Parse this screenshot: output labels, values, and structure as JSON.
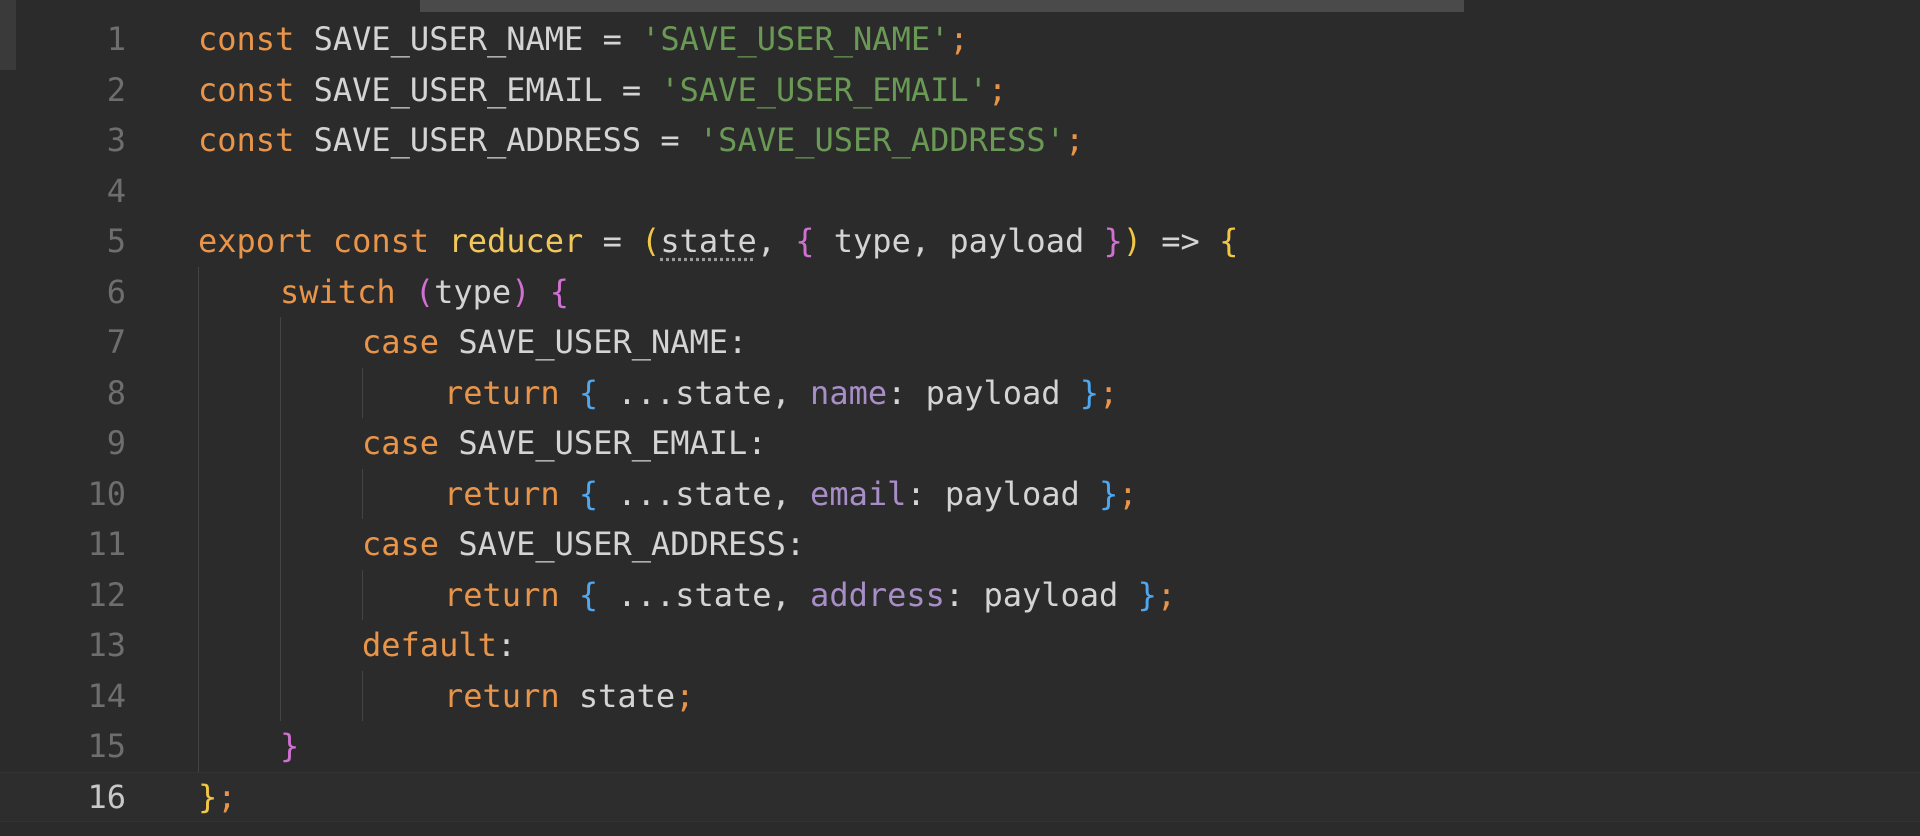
{
  "editor": {
    "language": "javascript",
    "current_line": 16,
    "colors": {
      "background": "#2b2b2b",
      "keyword": "#e8954a",
      "string": "#6a9955",
      "function": "#f0c75a",
      "property": "#a88ec7",
      "line_number": "#6e6e6e"
    },
    "lines": [
      {
        "n": "1",
        "indent": 0,
        "tokens": [
          {
            "t": "const",
            "c": "kw"
          },
          {
            "t": " SAVE_USER_NAME = ",
            "c": "plain"
          },
          {
            "t": "'SAVE_USER_NAME'",
            "c": "str"
          },
          {
            "t": ";",
            "c": "kw"
          }
        ]
      },
      {
        "n": "2",
        "indent": 0,
        "tokens": [
          {
            "t": "const",
            "c": "kw"
          },
          {
            "t": " SAVE_USER_EMAIL = ",
            "c": "plain"
          },
          {
            "t": "'SAVE_USER_EMAIL'",
            "c": "str"
          },
          {
            "t": ";",
            "c": "kw"
          }
        ]
      },
      {
        "n": "3",
        "indent": 0,
        "tokens": [
          {
            "t": "const",
            "c": "kw"
          },
          {
            "t": " SAVE_USER_ADDRESS = ",
            "c": "plain"
          },
          {
            "t": "'SAVE_USER_ADDRESS'",
            "c": "str"
          },
          {
            "t": ";",
            "c": "kw"
          }
        ]
      },
      {
        "n": "4",
        "indent": 0,
        "tokens": []
      },
      {
        "n": "5",
        "indent": 0,
        "tokens": [
          {
            "t": "export",
            "c": "kw"
          },
          {
            "t": " ",
            "c": "plain"
          },
          {
            "t": "const",
            "c": "kw"
          },
          {
            "t": " ",
            "c": "plain"
          },
          {
            "t": "reducer",
            "c": "fn"
          },
          {
            "t": " = ",
            "c": "plain"
          },
          {
            "t": "(",
            "c": "br-y"
          },
          {
            "t": "state",
            "c": "plain dotted"
          },
          {
            "t": ", ",
            "c": "plain"
          },
          {
            "t": "{",
            "c": "br-p"
          },
          {
            "t": " type, payload ",
            "c": "plain"
          },
          {
            "t": "}",
            "c": "br-p"
          },
          {
            "t": ")",
            "c": "br-y"
          },
          {
            "t": " => ",
            "c": "plain"
          },
          {
            "t": "{",
            "c": "br-y"
          }
        ]
      },
      {
        "n": "6",
        "indent": 1,
        "tokens": [
          {
            "t": "switch",
            "c": "kw"
          },
          {
            "t": " ",
            "c": "plain"
          },
          {
            "t": "(",
            "c": "br-p"
          },
          {
            "t": "type",
            "c": "plain"
          },
          {
            "t": ")",
            "c": "br-p"
          },
          {
            "t": " ",
            "c": "plain"
          },
          {
            "t": "{",
            "c": "br-p"
          }
        ]
      },
      {
        "n": "7",
        "indent": 2,
        "tokens": [
          {
            "t": "case",
            "c": "kw"
          },
          {
            "t": " SAVE_USER_NAME:",
            "c": "plain"
          }
        ]
      },
      {
        "n": "8",
        "indent": 3,
        "tokens": [
          {
            "t": "return",
            "c": "kw"
          },
          {
            "t": " ",
            "c": "plain"
          },
          {
            "t": "{",
            "c": "br-b"
          },
          {
            "t": " ...state, ",
            "c": "plain"
          },
          {
            "t": "name",
            "c": "prop"
          },
          {
            "t": ": payload ",
            "c": "plain"
          },
          {
            "t": "}",
            "c": "br-b"
          },
          {
            "t": ";",
            "c": "kw"
          }
        ]
      },
      {
        "n": "9",
        "indent": 2,
        "tokens": [
          {
            "t": "case",
            "c": "kw"
          },
          {
            "t": " SAVE_USER_EMAIL:",
            "c": "plain"
          }
        ]
      },
      {
        "n": "10",
        "indent": 3,
        "tokens": [
          {
            "t": "return",
            "c": "kw"
          },
          {
            "t": " ",
            "c": "plain"
          },
          {
            "t": "{",
            "c": "br-b"
          },
          {
            "t": " ...state, ",
            "c": "plain"
          },
          {
            "t": "email",
            "c": "prop"
          },
          {
            "t": ": payload ",
            "c": "plain"
          },
          {
            "t": "}",
            "c": "br-b"
          },
          {
            "t": ";",
            "c": "kw"
          }
        ]
      },
      {
        "n": "11",
        "indent": 2,
        "tokens": [
          {
            "t": "case",
            "c": "kw"
          },
          {
            "t": " SAVE_USER_ADDRESS:",
            "c": "plain"
          }
        ]
      },
      {
        "n": "12",
        "indent": 3,
        "tokens": [
          {
            "t": "return",
            "c": "kw"
          },
          {
            "t": " ",
            "c": "plain"
          },
          {
            "t": "{",
            "c": "br-b"
          },
          {
            "t": " ...state, ",
            "c": "plain"
          },
          {
            "t": "address",
            "c": "prop"
          },
          {
            "t": ": payload ",
            "c": "plain"
          },
          {
            "t": "}",
            "c": "br-b"
          },
          {
            "t": ";",
            "c": "kw"
          }
        ]
      },
      {
        "n": "13",
        "indent": 2,
        "tokens": [
          {
            "t": "default",
            "c": "kw"
          },
          {
            "t": ":",
            "c": "plain"
          }
        ]
      },
      {
        "n": "14",
        "indent": 3,
        "tokens": [
          {
            "t": "return",
            "c": "kw"
          },
          {
            "t": " state",
            "c": "plain"
          },
          {
            "t": ";",
            "c": "kw"
          }
        ]
      },
      {
        "n": "15",
        "indent": 1,
        "tokens": [
          {
            "t": "}",
            "c": "br-p"
          }
        ]
      },
      {
        "n": "16",
        "indent": 0,
        "tokens": [
          {
            "t": "}",
            "c": "br-y"
          },
          {
            "t": ";",
            "c": "kw"
          }
        ]
      }
    ]
  }
}
